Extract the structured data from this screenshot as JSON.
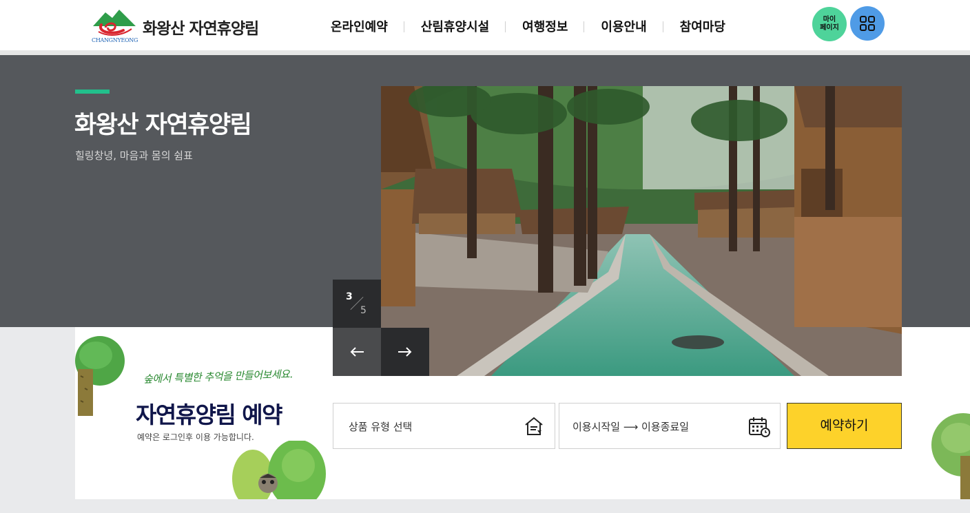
{
  "header": {
    "logo_text": "화왕산 자연휴양림",
    "logo_sub": "CHANGNYEONG",
    "nav": [
      "온라인예약",
      "산림휴양시설",
      "여행정보",
      "이용안내",
      "참여마당"
    ],
    "mypage_line1": "마이",
    "mypage_line2": "페이지",
    "menu_icon": "grid-icon"
  },
  "hero": {
    "title": "화왕산 자연휴양림",
    "subtitle": "힐링창녕, 마음과 몸의 쉼표",
    "slide_current": "3",
    "slide_total": "5"
  },
  "reservation": {
    "script_text": "숲에서 특별한 추억을 만들어보세요.",
    "title": "자연휴양림 예약",
    "note": "예약은 로그인후 이용 가능합니다.",
    "product_placeholder": "상품 유형 선택",
    "date_placeholder": "이용시작일 ⟶ 이용종료일",
    "submit": "예약하기"
  },
  "colors": {
    "hero_bg": "#55585c",
    "accent": "#22c08c",
    "reserve_button": "#fdd22a",
    "mypage_button": "#4ed39a",
    "menu_button": "#4f9be6"
  }
}
